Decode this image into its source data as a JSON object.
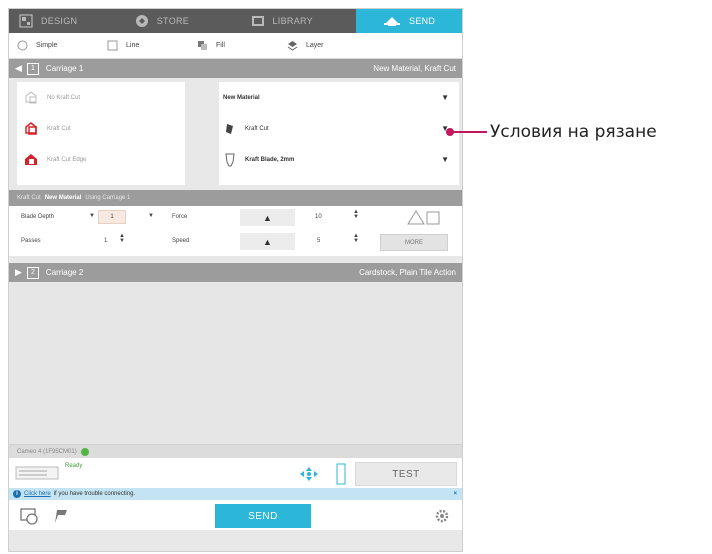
{
  "top_tabs": [
    {
      "label": "DESIGN",
      "icon": "design-icon"
    },
    {
      "label": "STORE",
      "icon": "store-icon"
    },
    {
      "label": "LIBRARY",
      "icon": "library-icon"
    },
    {
      "label": "SEND",
      "icon": "send-icon",
      "active": true
    }
  ],
  "modes": [
    {
      "label": "Simple",
      "icon": "simple-mode-icon"
    },
    {
      "label": "Line",
      "icon": "line-mode-icon"
    },
    {
      "label": "Fill",
      "icon": "fill-mode-icon"
    },
    {
      "label": "Layer",
      "icon": "layer-mode-icon"
    }
  ],
  "carriage1": {
    "number": "1",
    "title": "Carriage 1",
    "summary": "New Material, Kraft Cut",
    "cut_options": [
      {
        "label": "No Kraft Cut"
      },
      {
        "label": "Kraft Cut"
      },
      {
        "label": "Kraft Cut Edge"
      }
    ],
    "material": "New Material",
    "action": "Kraft Cut",
    "tool": "Kraft Blade, 2mm"
  },
  "settings": {
    "title_prefix": "Kraft Cut",
    "title_material": "New Material",
    "title_suffix": "Using Carriage 1",
    "blade_depth_label": "Blade Depth",
    "blade_depth_value": "1",
    "passes_label": "Passes",
    "passes_value": "1",
    "force_label": "Force",
    "force_value": "10",
    "speed_label": "Speed",
    "speed_value": "5",
    "more_label": "MORE"
  },
  "carriage2": {
    "number": "2",
    "title": "Carriage 2",
    "summary": "Cardstock, Plain Tile Action"
  },
  "device": {
    "name": "Cameo 4 (1F95CM01)",
    "status": "Ready",
    "test_label": "TEST"
  },
  "info": {
    "link": "Click here",
    "text": "if you have trouble connecting."
  },
  "bottom": {
    "send_label": "SEND"
  },
  "callout": {
    "text": "Условия на рязане"
  },
  "colors": {
    "accent": "#2cb7d8",
    "callout": "#c2185b",
    "cut_icon": "#d6232a",
    "ready": "#3fa33a"
  }
}
